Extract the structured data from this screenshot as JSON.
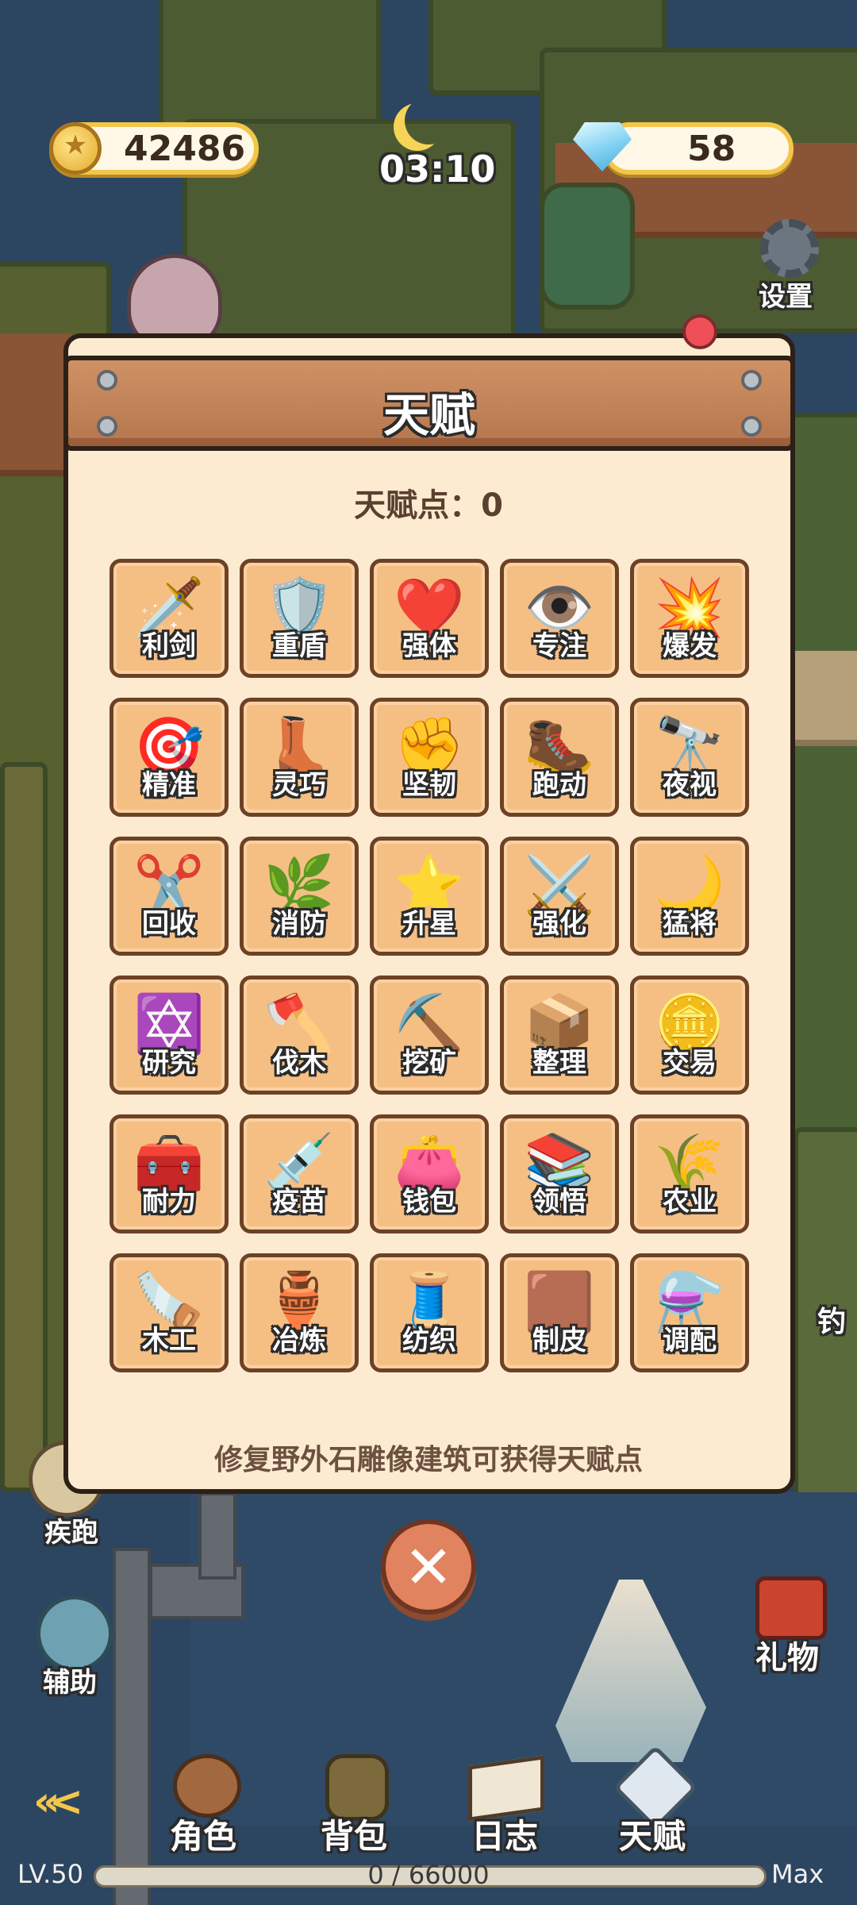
{
  "hud": {
    "coins": "42486",
    "time": "03:10",
    "gems": "58",
    "settings_label": "设置"
  },
  "side": {
    "sprint_label": "疾跑",
    "assist_label": "辅助",
    "gift_label": "礼物",
    "fishing_label": "钓"
  },
  "dialog": {
    "title": "天赋",
    "points_label": "天赋点：0",
    "hint": "修复野外石雕像建筑可获得天赋点",
    "talents": [
      {
        "label": "利剑",
        "icon": "🗡️"
      },
      {
        "label": "重盾",
        "icon": "🛡️"
      },
      {
        "label": "强体",
        "icon": "❤️"
      },
      {
        "label": "专注",
        "icon": "👁️"
      },
      {
        "label": "爆发",
        "icon": "💥"
      },
      {
        "label": "精准",
        "icon": "🎯"
      },
      {
        "label": "灵巧",
        "icon": "👢"
      },
      {
        "label": "坚韧",
        "icon": "✊"
      },
      {
        "label": "跑动",
        "icon": "🥾"
      },
      {
        "label": "夜视",
        "icon": "🔭"
      },
      {
        "label": "回收",
        "icon": "✂️"
      },
      {
        "label": "消防",
        "icon": "🌿"
      },
      {
        "label": "升星",
        "icon": "⭐"
      },
      {
        "label": "强化",
        "icon": "⚔️"
      },
      {
        "label": "猛将",
        "icon": "🌙"
      },
      {
        "label": "研究",
        "icon": "✡️"
      },
      {
        "label": "伐木",
        "icon": "🪓"
      },
      {
        "label": "挖矿",
        "icon": "⛏️"
      },
      {
        "label": "整理",
        "icon": "📦"
      },
      {
        "label": "交易",
        "icon": "🪙"
      },
      {
        "label": "耐力",
        "icon": "🧰"
      },
      {
        "label": "疫苗",
        "icon": "💉"
      },
      {
        "label": "钱包",
        "icon": "👛"
      },
      {
        "label": "领悟",
        "icon": "📚"
      },
      {
        "label": "农业",
        "icon": "🌾"
      },
      {
        "label": "木工",
        "icon": "🪚"
      },
      {
        "label": "冶炼",
        "icon": "🏺"
      },
      {
        "label": "纺织",
        "icon": "🧵"
      },
      {
        "label": "制皮",
        "icon": "🟫"
      },
      {
        "label": "调配",
        "icon": "⚗️"
      }
    ]
  },
  "nav": {
    "role": "角色",
    "bag": "背包",
    "journal": "日志",
    "talent": "天赋"
  },
  "level": {
    "lv": "LV.50",
    "xp": "0 / 66000",
    "xp_fraction": 0,
    "max": "Max"
  }
}
